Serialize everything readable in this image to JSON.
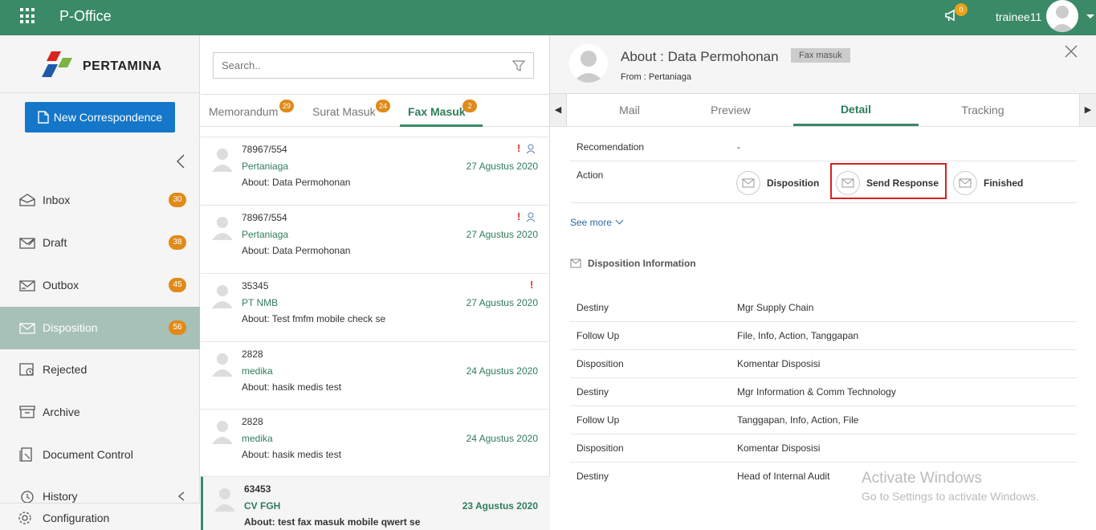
{
  "topbar": {
    "app_title": "P-Office",
    "notification_count": "0",
    "username": "trainee11",
    "brand_color": "#3a8a67"
  },
  "sidebar": {
    "logo_text": "PERTAMINA",
    "new_button": "New Correspondence",
    "items": [
      {
        "label": "Inbox",
        "count": "30",
        "icon": "inbox-icon"
      },
      {
        "label": "Draft",
        "count": "38",
        "icon": "draft-icon"
      },
      {
        "label": "Outbox",
        "count": "45",
        "icon": "outbox-icon"
      },
      {
        "label": "Disposition",
        "count": "56",
        "icon": "disposition-icon"
      },
      {
        "label": "Rejected",
        "count": "",
        "icon": "rejected-icon"
      },
      {
        "label": "Archive",
        "count": "",
        "icon": "archive-icon"
      },
      {
        "label": "Document Control",
        "count": "",
        "icon": "document-control-icon"
      },
      {
        "label": "History",
        "count": "",
        "icon": "history-icon"
      }
    ],
    "configuration": "Configuration"
  },
  "middle": {
    "search_placeholder": "Search..",
    "tabs": [
      {
        "label": "Memorandum",
        "count": "29"
      },
      {
        "label": "Surat Masuk",
        "count": "24"
      },
      {
        "label": "Fax Masuk",
        "count": "2"
      }
    ],
    "items": [
      {
        "number": "78967/554",
        "sender": "Pertaniaga",
        "date": "27 Agustus 2020",
        "about": "About: Data Permohonan"
      },
      {
        "number": "78967/554",
        "sender": "Pertaniaga",
        "date": "27 Agustus 2020",
        "about": "About: Data Permohonan"
      },
      {
        "number": "35345",
        "sender": "PT NMB",
        "date": "27 Agustus 2020",
        "about": "About: Test fmfm mobile check se"
      },
      {
        "number": "2828",
        "sender": "medika",
        "date": "24 Agustus 2020",
        "about": "About: hasik medis test"
      },
      {
        "number": "2828",
        "sender": "medika",
        "date": "24 Agustus 2020",
        "about": "About: hasik medis test"
      },
      {
        "number": "63453",
        "sender": "CV FGH",
        "date": "23 Agustus 2020",
        "about": "About: test fax masuk mobile qwert se"
      }
    ]
  },
  "detail": {
    "title": "About : Data Permohonan",
    "tag": "Fax masuk",
    "from": "From : Pertaniaga",
    "tabs": [
      "Mail",
      "Preview",
      "Detail",
      "Tracking"
    ],
    "recommendation_label": "Recomendation",
    "recommendation_value": "-",
    "action_label": "Action",
    "actions": [
      "Disposition",
      "Send Response",
      "Finished"
    ],
    "see_more": "See more",
    "disposition_info_title": "Disposition Information",
    "rows": [
      {
        "key": "Destiny",
        "value": "Mgr Supply Chain"
      },
      {
        "key": "Follow Up",
        "value": "File, Info, Action, Tanggapan"
      },
      {
        "key": "Disposition",
        "value": "Komentar Disposisi"
      },
      {
        "key": "Destiny",
        "value": "Mgr Information & Comm Technology"
      },
      {
        "key": "Follow Up",
        "value": "Tanggapan, Info, Action, File"
      },
      {
        "key": "Disposition",
        "value": "Komentar Disposisi"
      },
      {
        "key": "Destiny",
        "value": "Head of Internal Audit"
      }
    ]
  },
  "watermark": {
    "line1": "Activate Windows",
    "line2": "Go to Settings to activate Windows."
  }
}
